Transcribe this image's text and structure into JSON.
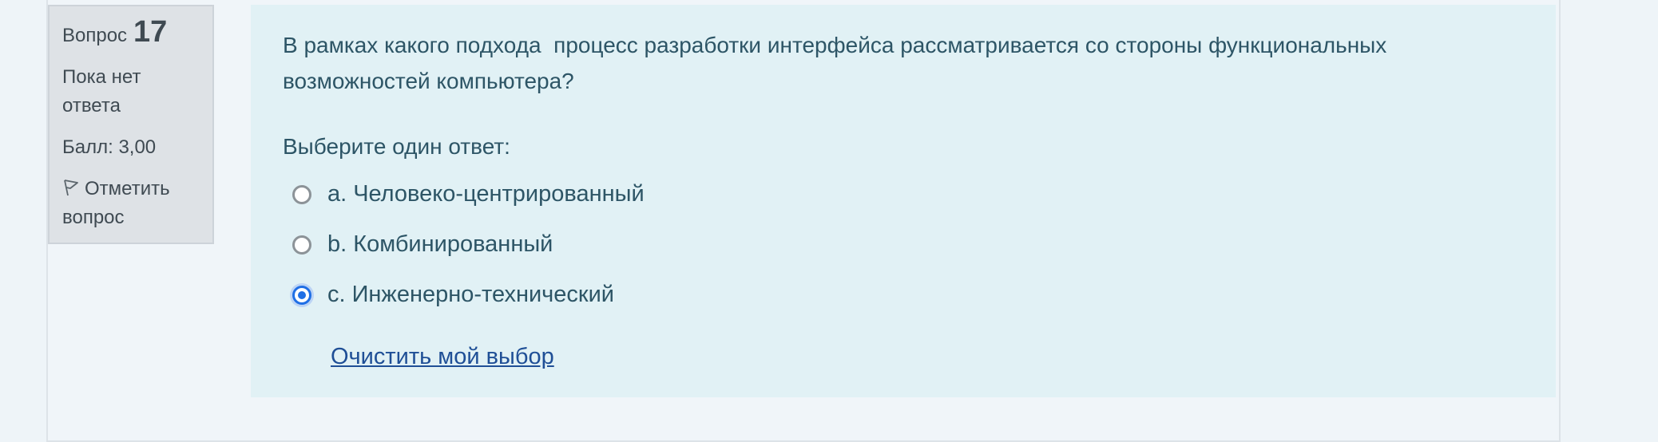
{
  "info": {
    "question_label": "Вопрос",
    "question_number": "17",
    "state": "Пока нет ответа",
    "grade": "Балл: 3,00",
    "flag_label": "Отметить вопрос"
  },
  "question": {
    "text": "В рамках какого подхода  процесс разработки интерфейса рассматривается со стороны функциональных возможностей компьютера?",
    "prompt": "Выберите один ответ:",
    "answers": [
      {
        "letter": "a.",
        "label": "Человеко-центрированный",
        "selected": false
      },
      {
        "letter": "b.",
        "label": "Комбинированный",
        "selected": false
      },
      {
        "letter": "c.",
        "label": "Инженерно-технический",
        "selected": true
      }
    ],
    "clear_label": "Очистить мой выбор"
  },
  "colors": {
    "content_bg": "#e1f1f5",
    "info_bg": "#dee2e6",
    "radio_selected": "#1f6fe5",
    "link": "#1f4f96"
  },
  "icons": {
    "flag": "flag-icon"
  }
}
